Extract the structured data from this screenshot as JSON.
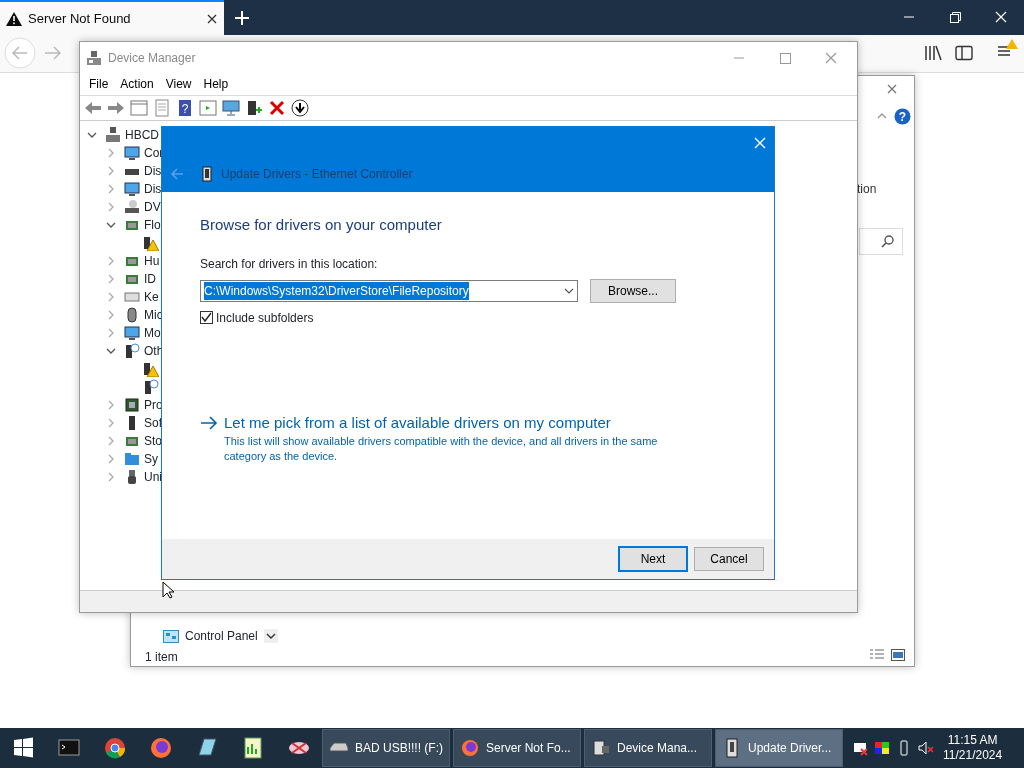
{
  "browser": {
    "tabs": [
      {
        "title": "Server Not Found",
        "selected": true
      }
    ]
  },
  "explorer": {
    "help_glyph": "?",
    "ribbon_fragment": "tion",
    "nav_items": [
      {
        "label": "Control Panel"
      }
    ],
    "status": "1 item"
  },
  "device_manager": {
    "title": "Device Manager",
    "menu": [
      "File",
      "Action",
      "View",
      "Help"
    ],
    "help_glyph": "?",
    "tree": [
      {
        "label": "HBCD",
        "kind": "computer",
        "expanded": true,
        "children": [
          {
            "label": "Cor",
            "kind": "monitor",
            "expanded": false
          },
          {
            "label": "Dis",
            "kind": "drive",
            "expanded": false
          },
          {
            "label": "Dis",
            "kind": "monitor",
            "expanded": false
          },
          {
            "label": "DV",
            "kind": "disc",
            "expanded": false
          },
          {
            "label": "Flo",
            "kind": "board",
            "expanded": true,
            "children": [
              {
                "kind": "warning"
              }
            ]
          },
          {
            "label": "Hu",
            "kind": "board",
            "expanded": false
          },
          {
            "label": "ID",
            "kind": "board",
            "expanded": false
          },
          {
            "label": "Ke",
            "kind": "keyboard",
            "expanded": false
          },
          {
            "label": "Mic",
            "kind": "mouse",
            "expanded": false
          },
          {
            "label": "Mo",
            "kind": "monitor",
            "expanded": false
          },
          {
            "label": "Oth",
            "kind": "unknown",
            "expanded": true,
            "children": [
              {
                "kind": "warning"
              },
              {
                "kind": "unknown"
              }
            ]
          },
          {
            "label": "Pro",
            "kind": "chip",
            "expanded": false
          },
          {
            "label": "Sof",
            "kind": "tower",
            "expanded": false
          },
          {
            "label": "Sto",
            "kind": "board",
            "expanded": false
          },
          {
            "label": "Sy",
            "kind": "folder",
            "expanded": false
          },
          {
            "label": "Uni",
            "kind": "usb",
            "expanded": false
          }
        ]
      }
    ]
  },
  "dialog": {
    "title": "Update Drivers - Ethernet Controller",
    "heading": "Browse for drivers on your computer",
    "location_label": "Search for drivers in this location:",
    "location_value": "C:\\Windows\\System32\\DriverStore\\FileRepository",
    "browse": "Browse...",
    "include_subfolders": {
      "label": "Include subfolders",
      "checked": true
    },
    "link": {
      "title": "Let me pick from a list of available drivers on my computer",
      "description": "This list will show available drivers compatible with the device, and all drivers in the same category as the device."
    },
    "buttons": [
      {
        "label": "Next",
        "default": true
      },
      {
        "label": "Cancel",
        "default": false
      }
    ]
  },
  "taskbar": {
    "tasks": [
      {
        "label": "BAD USB!!!! (F:)",
        "kind": "drive",
        "selected": false
      },
      {
        "label": "Server Not Fo...",
        "kind": "firefox",
        "selected": false
      },
      {
        "label": "Device Mana...",
        "kind": "devmgr",
        "selected": false
      },
      {
        "label": "Update Driver...",
        "kind": "device",
        "selected": true
      }
    ],
    "time": "11:15 AM",
    "date": "11/21/2024"
  }
}
